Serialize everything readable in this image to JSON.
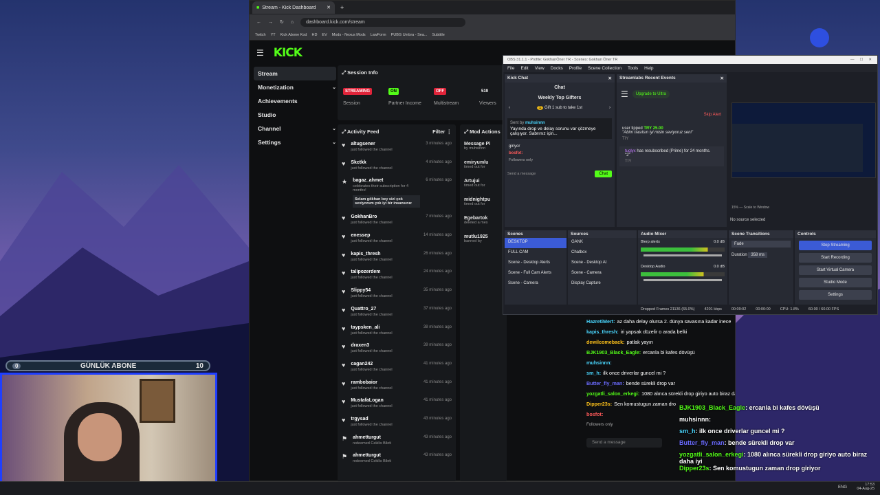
{
  "browser": {
    "tab_title": "Stream - Kick Dashboard",
    "url": "dashboard.kick.com/stream",
    "bookmarks": [
      "Twitch",
      "YT",
      "Kick Abone Kod",
      "HD",
      "EV",
      "Mods - Nexus Mods",
      "LawForm",
      "PUBG Umbra - Sea...",
      "Subtitle"
    ]
  },
  "kick": {
    "logo": "KICK",
    "sidebar": [
      {
        "label": "Stream",
        "active": true
      },
      {
        "label": "Monetization"
      },
      {
        "label": "Achievements"
      },
      {
        "label": "Studio"
      },
      {
        "label": "Channel"
      },
      {
        "label": "Settings"
      }
    ],
    "session_title": "Session Info",
    "session": [
      {
        "badge": "STREAMING",
        "label": "Session",
        "color": "#e0243a"
      },
      {
        "badge": "ON",
        "label": "Partner Income",
        "color": "#53fc18"
      },
      {
        "badge": "OFF",
        "label": "Multistream",
        "color": "#e0243a"
      },
      {
        "badge": "519",
        "label": "Viewers"
      },
      {
        "badge": "66,56",
        "label": "Follo"
      }
    ],
    "feed_title": "Activity Feed",
    "feed_filter": "Filter",
    "mod_title": "Mod Actions",
    "feed": [
      {
        "name": "altugsener",
        "sub": "just followed the channel",
        "time": "3 minutes ago",
        "icon": "heart"
      },
      {
        "name": "Skctkk",
        "sub": "just followed the channel",
        "time": "4 minutes ago",
        "icon": "heart"
      },
      {
        "name": "bagaz_ahmet",
        "sub": "celebrates their subscription for 4 months!",
        "time": "6 minutes ago",
        "icon": "star",
        "msg": "Selam gökhan bey sizi çok seviyorum çok iyi bir insansınız"
      },
      {
        "name": "GokhanBro",
        "sub": "just followed the channel",
        "time": "7 minutes ago",
        "icon": "heart"
      },
      {
        "name": "enessep",
        "sub": "just followed the channel",
        "time": "14 minutes ago",
        "icon": "heart"
      },
      {
        "name": "kapis_thresh",
        "sub": "just followed the channel",
        "time": "26 minutes ago",
        "icon": "heart"
      },
      {
        "name": "talipozerdem",
        "sub": "just followed the channel",
        "time": "24 minutes ago",
        "icon": "heart"
      },
      {
        "name": "Slippy54",
        "sub": "just followed the channel",
        "time": "35 minutes ago",
        "icon": "heart"
      },
      {
        "name": "Quattro_27",
        "sub": "just followed the channel",
        "time": "37 minutes ago",
        "icon": "heart"
      },
      {
        "name": "taypsken_ali",
        "sub": "just followed the channel",
        "time": "38 minutes ago",
        "icon": "heart"
      },
      {
        "name": "draxen3",
        "sub": "just followed the channel",
        "time": "39 minutes ago",
        "icon": "heart"
      },
      {
        "name": "cagan242",
        "sub": "just followed the channel",
        "time": "41 minutes ago",
        "icon": "heart"
      },
      {
        "name": "rambobaior",
        "sub": "just followed the channel",
        "time": "41 minutes ago",
        "icon": "heart"
      },
      {
        "name": "MustafaLogan",
        "sub": "just followed the channel",
        "time": "41 minutes ago",
        "icon": "heart"
      },
      {
        "name": "trgysad",
        "sub": "just followed the channel",
        "time": "43 minutes ago",
        "icon": "heart"
      },
      {
        "name": "ahmetturgut",
        "sub": "redeemed Cekilis Bileti",
        "time": "43 minutes ago",
        "icon": "gift"
      },
      {
        "name": "ahmetturgut",
        "sub": "redeemed Cekilis Bileti",
        "time": "43 minutes ago",
        "icon": "gift"
      }
    ],
    "mod": [
      {
        "t1": "Message Pi",
        "t2": "by muhsinnn"
      },
      {
        "t1": "emiryumlu",
        "t2": "timed out for"
      },
      {
        "t1": "Artujui",
        "t2": "timed out for"
      },
      {
        "t1": "midnightpu",
        "t2": "timed out for"
      },
      {
        "t1": "Egebartok",
        "t2": "deleted a mes"
      },
      {
        "t1": "mutlu1925",
        "t2": "banned by"
      }
    ]
  },
  "obs": {
    "title": "OBS 31.1.1 - Profile: GokhanÖner TR - Scenes: Gokhan Öner TR",
    "menu": [
      "File",
      "Edit",
      "View",
      "Docks",
      "Profile",
      "Scene Collection",
      "Tools",
      "Help"
    ],
    "kick_chat": {
      "title": "Kick Chat",
      "header": "Chat",
      "gifters": "Weekly Top Gifters",
      "gift": "Gift 1 sub to take 1st",
      "pinned_by": "Sent by",
      "pinned_user": "muhsinnn",
      "pinned": "Yayında drop ve delay sorunu var çözmeye çalışıyor. Sabrınız için...",
      "line1": "giriyor",
      "user2": "bosfot:",
      "followers": "Followers only",
      "send": "Send a message",
      "chat_btn": "Chat"
    },
    "recent": {
      "title": "Streamlabs Recent Events",
      "upgrade": "Upgrade to Ultra",
      "skip": "Skip Alert",
      "tip_user": "user tipped",
      "tip_amt": "TRY 25.00",
      "tip_msg": "\"Abim nasılsın iyi misin seviyoruz seni\"",
      "tag1": "TIY",
      "resub_user": "tuglyx",
      "resub": "has resubscribed (Prime) for 24 months.",
      "resub_msg": "\"2\"",
      "tag2": "TIY"
    },
    "no_source": "No source selected",
    "zoom": "15%",
    "scale": "Scale to Window",
    "scenes": {
      "title": "Scenes",
      "items": [
        "DESKTOP",
        "FULL CAM",
        "Scene - Desktop Alerts",
        "Scene - Full Cam Alerts",
        "Scene - Camera"
      ]
    },
    "sources": {
      "title": "Sources",
      "items": [
        "GANK",
        "Chatbox",
        "Scene - Desktop Al",
        "Scene - Camera",
        "Display Capture"
      ]
    },
    "mixer": {
      "title": "Audio Mixer",
      "ch1": "Blerp alerts",
      "db1": "0.0 dB",
      "ch2": "Desktop Audio",
      "db2": "0.0 dB"
    },
    "trans": {
      "title": "Scene Transitions",
      "type": "Fade",
      "dur_label": "Duration",
      "dur": "358 ms"
    },
    "controls": {
      "title": "Controls",
      "buttons": [
        "Stop Streaming",
        "Start Recording",
        "Start Virtual Camera",
        "Studio Mode",
        "Settings"
      ]
    },
    "status": {
      "frames": "Dropped Frames 21136 (65.0%)",
      "kbps": "4201 kbps",
      "t1": "00:09:02",
      "t2": "00:00:00",
      "cpu": "CPU: 1.8%",
      "fps": "60.00 / 60.00 FPS"
    }
  },
  "chat_small": [
    {
      "u": "HazretiMert:",
      "c": "#4ad7ff",
      "m": "az daha delay olursa 2. dünya savasına kadar inece"
    },
    {
      "u": "kapis_thresh:",
      "c": "#4ad7ff",
      "m": "iri yapsak düzelir o arada belki"
    },
    {
      "u": "dewilcomeback:",
      "c": "#ffc21a",
      "m": "patlak yayın"
    },
    {
      "u": "BJK1903_Black_Eagle:",
      "c": "#53fc18",
      "m": "ercanla bi kafes dövüşü"
    },
    {
      "u": "muhsinnn:",
      "c": "#4ad7ff",
      "m": ""
    },
    {
      "u": "sm_h:",
      "c": "#4ad7ff",
      "m": "ilk once driverlar guncel mi ?"
    },
    {
      "u": "Butter_fly_man:",
      "c": "#6b6bff",
      "m": "bende sürekli drop var"
    },
    {
      "u": "yozgatli_salon_erkegi:",
      "c": "#53fc18",
      "m": "1080 alınca sürekli drop giriyo auto biraz daha"
    },
    {
      "u": "Dipper23s:",
      "c": "#ffc21a",
      "m": "Sen komustugun zaman dro"
    },
    {
      "u": "bosfot:",
      "c": "#ff5a5a",
      "m": ""
    }
  ],
  "chat_small_followers": "Followers only",
  "chat_small_send": "Send a message",
  "chat_big": [
    {
      "u": "BJK1903_Black_Eagle",
      "c": "#53fc18",
      "m": ": ercanla bi kafes dövüşü"
    },
    {
      "u": "muhsinnn",
      "c": "#ffffff",
      "m": ":"
    },
    {
      "u": "sm_h",
      "c": "#4ad7ff",
      "m": ": ilk once driverlar guncel mi ?"
    },
    {
      "u": "Butter_fly_man",
      "c": "#6b6bff",
      "m": ": bende sürekli drop var"
    },
    {
      "u": "yozgatli_salon_erkegi",
      "c": "#53fc18",
      "m": ": 1080 alınca sürekli drop giriyo auto biraz daha iyi"
    },
    {
      "u": "Dipper23s",
      "c": "#53fc18",
      "m": ": Sen komustugun zaman drop giriyor"
    }
  ],
  "goal": {
    "label": "GÜNLÜK ABONE",
    "current": "0",
    "target": "10"
  },
  "taskbar": {
    "lang": "ENG",
    "time": "17:53",
    "date": "04-Aug-25"
  }
}
